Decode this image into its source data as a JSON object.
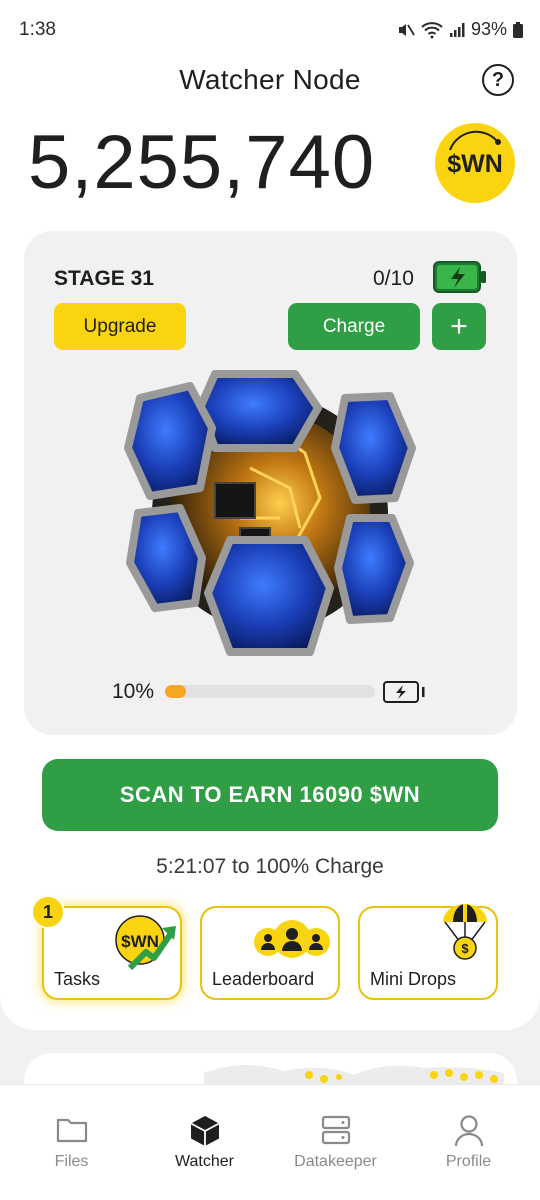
{
  "status_bar": {
    "time": "1:38",
    "battery": "93%"
  },
  "header": {
    "title": "Watcher Node",
    "help_icon": "question-circle-icon"
  },
  "balance": {
    "amount": "5,255,740",
    "token_logo_text": "$WN"
  },
  "stage": {
    "label": "STAGE 31",
    "charges": "0/10",
    "upgrade_label": "Upgrade",
    "charge_label": "Charge",
    "plus_label": "+",
    "progress_text": "10%",
    "progress_value": 0.1
  },
  "scan_button": {
    "label": "SCAN TO EARN 16090 $WN"
  },
  "charge_timer": "5:21:07 to 100% Charge",
  "tiles": [
    {
      "label": "Tasks",
      "icon": "wn-coin-trend-icon",
      "badge": "1"
    },
    {
      "label": "Leaderboard",
      "icon": "people-group-icon"
    },
    {
      "label": "Mini Drops",
      "icon": "parachute-coin-icon"
    }
  ],
  "bottom_nav": [
    {
      "label": "Files",
      "icon": "folder-icon",
      "active": false
    },
    {
      "label": "Watcher",
      "icon": "cube-icon",
      "active": true
    },
    {
      "label": "Datakeeper",
      "icon": "server-icon",
      "active": false
    },
    {
      "label": "Profile",
      "icon": "person-icon",
      "active": false
    }
  ],
  "colors": {
    "accent_green": "#2f9e44",
    "accent_yellow": "#f9d40f",
    "progress_orange": "#f5a623"
  }
}
